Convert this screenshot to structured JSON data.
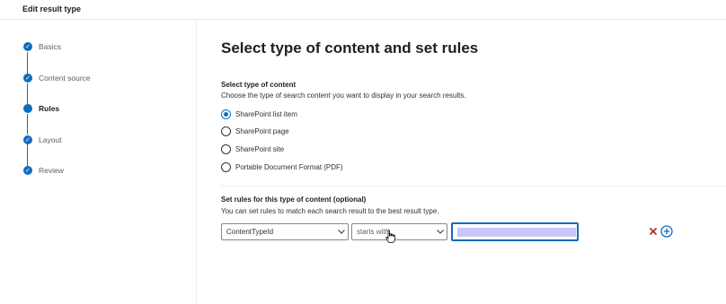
{
  "header": {
    "title": "Edit result type"
  },
  "steps": [
    {
      "label": "Basics",
      "state": "done"
    },
    {
      "label": "Content source",
      "state": "done"
    },
    {
      "label": "Rules",
      "state": "current"
    },
    {
      "label": "Layout",
      "state": "done"
    },
    {
      "label": "Review",
      "state": "done"
    }
  ],
  "main": {
    "title": "Select type of content and set rules",
    "content_type": {
      "title": "Select type of content",
      "description": "Choose the type of search content you want to display in your search results.",
      "options": [
        {
          "label": "SharePoint list item",
          "selected": true
        },
        {
          "label": "SharePoint page",
          "selected": false
        },
        {
          "label": "SharePoint site",
          "selected": false
        },
        {
          "label": "Portable Document Format (PDF)",
          "selected": false
        }
      ]
    },
    "rules": {
      "title": "Set rules for this type of content (optional)",
      "description": "You can set rules to match each search result to the best result type.",
      "property_value": "ContentTypeId",
      "operator_value": "starts with"
    }
  },
  "colors": {
    "accent": "#0f6cbd",
    "remove": "#a4262c",
    "highlight": "#c8c6f7"
  },
  "icons": {
    "check": "check-icon",
    "remove": "close-icon",
    "add": "add-circle-icon",
    "dropdown": "chevron-down-icon"
  }
}
